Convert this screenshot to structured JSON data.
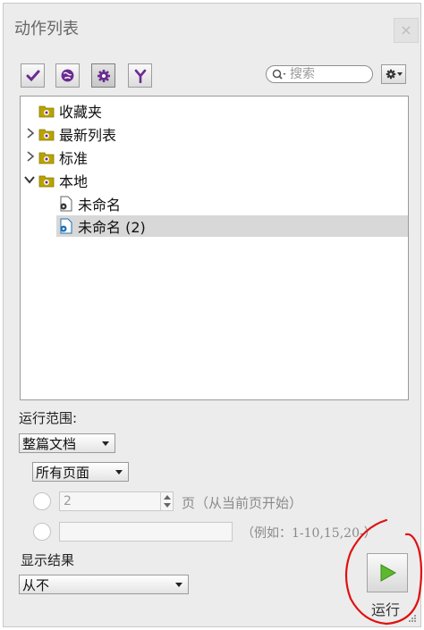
{
  "window": {
    "title": "动作列表",
    "close_symbol": "×"
  },
  "toolbar": {
    "buttons": [
      {
        "icon": "checkmark-icon"
      },
      {
        "icon": "globe-icon"
      },
      {
        "icon": "gear-icon"
      },
      {
        "icon": "branch-icon"
      }
    ],
    "search_placeholder": "搜索"
  },
  "tree": {
    "items": [
      {
        "label": "收藏夹",
        "type": "folder",
        "level": 0,
        "expandable": false
      },
      {
        "label": "最新列表",
        "type": "folder",
        "level": 0,
        "expandable": true,
        "expanded": false
      },
      {
        "label": "标准",
        "type": "folder",
        "level": 0,
        "expandable": true,
        "expanded": false
      },
      {
        "label": "本地",
        "type": "folder",
        "level": 0,
        "expandable": true,
        "expanded": true
      },
      {
        "label": "未命名",
        "type": "file",
        "level": 1
      },
      {
        "label": "未命名 (2)",
        "type": "file",
        "level": 1,
        "selected": true
      }
    ]
  },
  "range": {
    "label": "运行范围:",
    "scope_value": "整篇文档",
    "pages_value": "所有页面",
    "page_number_value": "2",
    "page_suffix": "页（从当前页开始）",
    "range_example": "（例如：1-10,15,20-）"
  },
  "results": {
    "label": "显示结果",
    "value": "从不"
  },
  "run": {
    "label": "运行"
  },
  "colors": {
    "accent_purple": "#6a2c91",
    "run_green": "#5db82e",
    "annotation_red": "#e01010"
  }
}
